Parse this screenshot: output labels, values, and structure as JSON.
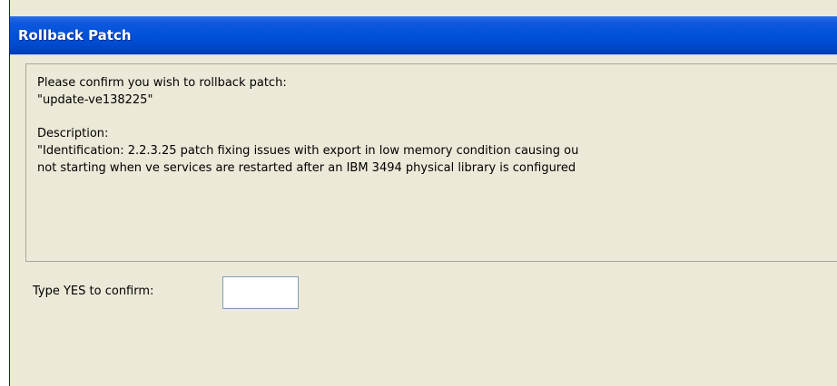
{
  "window": {
    "title": "Rollback Patch"
  },
  "message": {
    "line1": "Please confirm you wish to rollback patch:",
    "line2": "\"update-ve138225\"",
    "description_label": "Description:",
    "description_line1": "\"Identification: 2.2.3.25 patch fixing issues with export in low memory condition causing ou",
    "description_line2": "not starting when ve services are restarted after an IBM 3494 physical library is configured"
  },
  "confirm": {
    "label": "Type YES to confirm:",
    "value": ""
  },
  "colors": {
    "titlebar": "#0052da",
    "dialog_bg": "#ece9d8",
    "input_border": "#7f9db9"
  }
}
